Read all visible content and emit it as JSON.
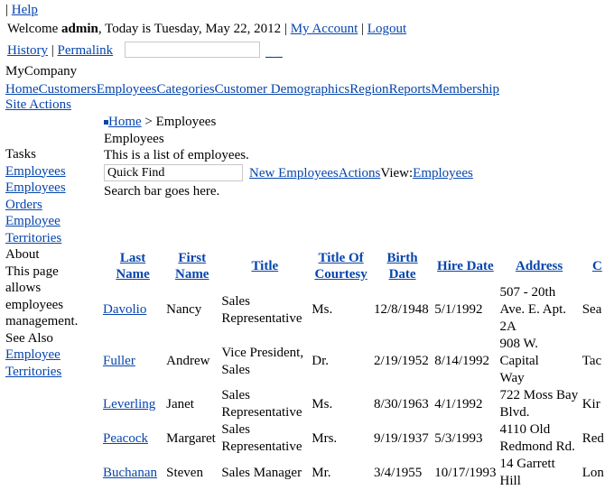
{
  "header": {
    "sep": "|",
    "help_label": "Help",
    "welcome_prefix": "Welcome ",
    "user": "admin",
    "today_text": ", Today is Tuesday, May 22, 2012 |",
    "my_account_label": "My Account",
    "sep2": "|",
    "logout_label": "Logout",
    "history_label": "History",
    "sep3": "|",
    "permalink_label": "Permalink",
    "search_value": "",
    "go_label": "_ _"
  },
  "company": "MyCompany",
  "menu": [
    "Home",
    "Customers",
    "Employees",
    "Categories",
    "Customer Demographics",
    "Region",
    "Reports",
    "Membership"
  ],
  "site_actions_label": "Site Actions",
  "sidebar": {
    "tasks_title": "Tasks",
    "tasks": [
      "Employees",
      "Employees",
      "Orders",
      "Employee",
      "Territories"
    ],
    "about_title": "About",
    "about_text": [
      "This page",
      "allows",
      "employees",
      "management."
    ],
    "see_also_title": "See Also",
    "see_also": [
      "Employee",
      "Territories"
    ]
  },
  "breadcrumb": {
    "home": "Home",
    "separator": " > ",
    "current": "Employees"
  },
  "page": {
    "title": "Employees",
    "description": "This is a list of employees.",
    "quick_find": "Quick Find",
    "new_label": "New Employees",
    "actions_label": "Actions",
    "view_label": "View:",
    "view_value": "Employees",
    "search_bar_text": "Search bar goes here."
  },
  "grid": {
    "columns": [
      [
        "Last",
        "Name"
      ],
      [
        "First",
        "Name"
      ],
      [
        "Title"
      ],
      [
        "Title Of",
        "Courtesy"
      ],
      [
        "Birth",
        "Date"
      ],
      [
        "Hire Date"
      ],
      [
        "Address"
      ],
      [
        "C"
      ]
    ],
    "rows": [
      {
        "last": "Davolio",
        "first": "Nancy",
        "title": [
          "Sales",
          "Representative"
        ],
        "courtesy": "Ms.",
        "birth": "12/8/1948",
        "hire": "5/1/1992",
        "address": [
          "507 - 20th",
          "Ave. E. Apt.",
          "2A"
        ],
        "city": "Sea"
      },
      {
        "last": "Fuller",
        "first": "Andrew",
        "title": [
          "Vice President,",
          "Sales"
        ],
        "courtesy": "Dr.",
        "birth": "2/19/1952",
        "hire": "8/14/1992",
        "address": [
          "908 W. Capital",
          "Way"
        ],
        "city": "Tac"
      },
      {
        "last": "Leverling",
        "first": "Janet",
        "title": [
          "Sales",
          "Representative"
        ],
        "courtesy": "Ms.",
        "birth": "8/30/1963",
        "hire": "4/1/1992",
        "address": [
          "722 Moss Bay",
          "Blvd."
        ],
        "city": "Kir"
      },
      {
        "last": "Peacock",
        "first": "Margaret",
        "title": [
          "Sales",
          "Representative"
        ],
        "courtesy": "Mrs.",
        "birth": "9/19/1937",
        "hire": "5/3/1993",
        "address": [
          "4110 Old",
          "Redmond Rd."
        ],
        "city": "Red"
      },
      {
        "last": "Buchanan",
        "first": "Steven",
        "title": [
          "Sales Manager"
        ],
        "courtesy": "Mr.",
        "birth": "3/4/1955",
        "hire": "10/17/1993",
        "address": [
          "14 Garrett Hill"
        ],
        "city": "Lon"
      }
    ]
  }
}
